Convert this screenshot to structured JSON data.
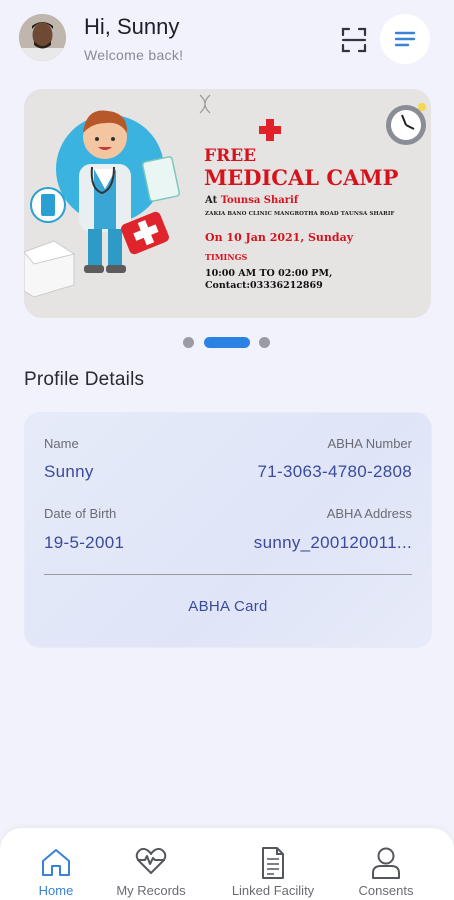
{
  "header": {
    "greeting": "Hi, Sunny",
    "subtitle": "Welcome back!",
    "scan_icon": "scan-frame-icon",
    "menu_icon": "menu-lines-icon"
  },
  "banner": {
    "line1": "FREE",
    "line2": "MEDICAL CAMP",
    "at_prefix": "At",
    "place": "Tounsa Sharif",
    "address": "ZAKIA BANO CLINIC MANGROTHA ROAD TAUNSA SHARIF",
    "date": "On 10 Jan 2021, Sunday",
    "timings_label": "TIMINGS",
    "time": "10:00 AM TO 02:00 PM,",
    "contact": "Contact:03336212869"
  },
  "carousel": {
    "count": 3,
    "active_index": 1
  },
  "profile": {
    "section_title": "Profile Details",
    "name_label": "Name",
    "name_value": "Sunny",
    "abha_number_label": "ABHA Number",
    "abha_number_value": "71-3063-4780-2808",
    "dob_label": "Date of Birth",
    "dob_value": "19-5-2001",
    "abha_address_label": "ABHA Address",
    "abha_address_value": "sunny_200120011...",
    "abha_card_label": "ABHA Card"
  },
  "nav": [
    {
      "label": "Home",
      "icon": "home-icon",
      "active": true
    },
    {
      "label": "My Records",
      "icon": "heart-pulse-icon",
      "active": false
    },
    {
      "label": "Linked Facility",
      "icon": "document-icon",
      "active": false
    },
    {
      "label": "Consents",
      "icon": "person-icon",
      "active": false
    }
  ],
  "colors": {
    "background": "#f1f2fb",
    "accent": "#3b82d6",
    "value_text": "#3b4b9c",
    "banner_red": "#d6131d"
  }
}
